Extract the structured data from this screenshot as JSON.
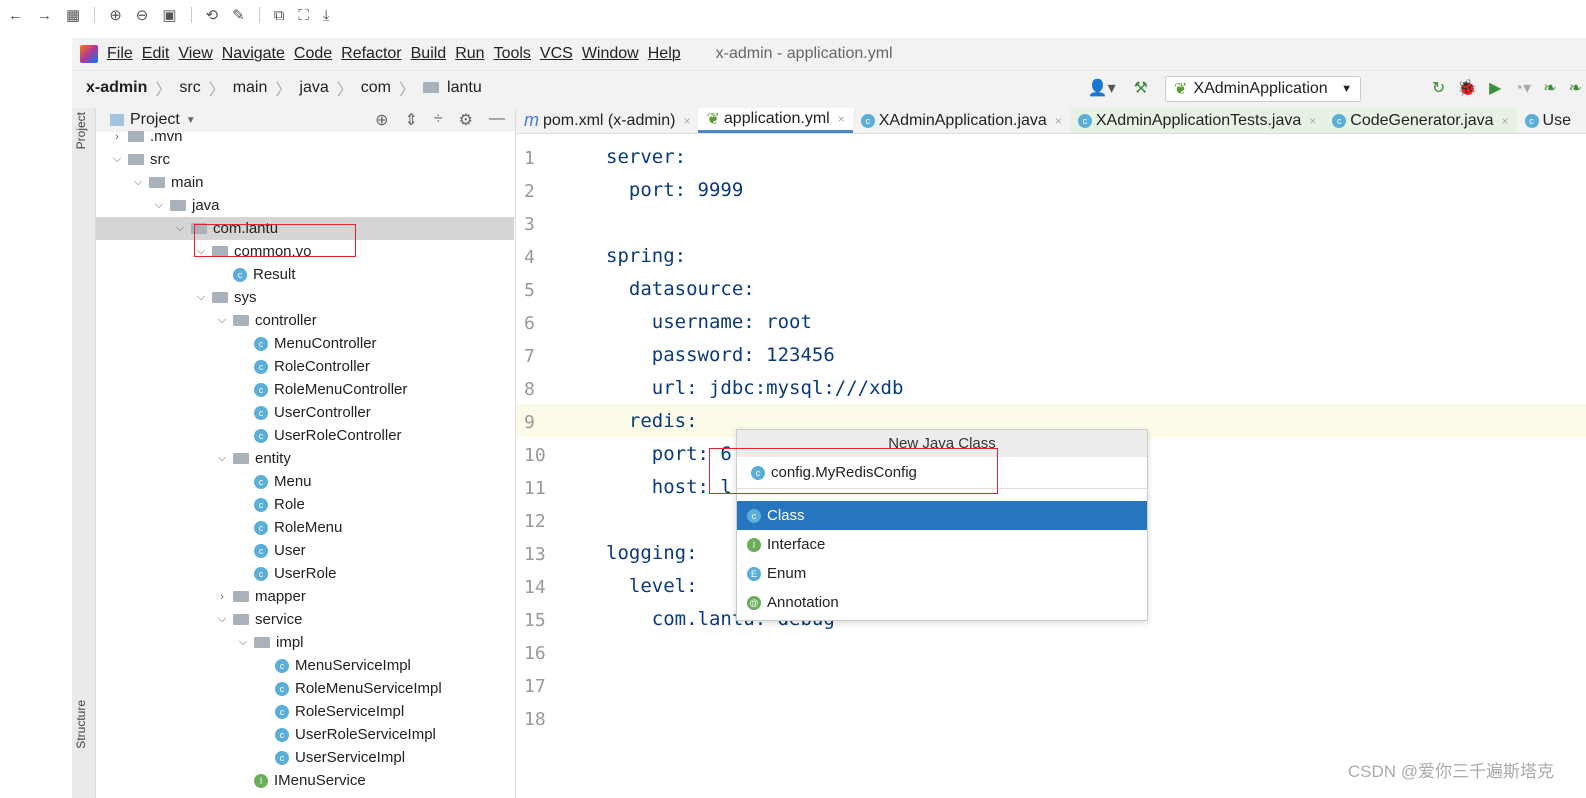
{
  "viewer_toolbar": {
    "icons": [
      "back-icon",
      "forward-icon",
      "grid-icon",
      "zoom-in-icon",
      "zoom-out-icon",
      "actual-size-icon",
      "rotate-icon",
      "edit-icon",
      "copy-text-icon",
      "screenshot-icon",
      "download-icon"
    ]
  },
  "menu": {
    "items": [
      "File",
      "Edit",
      "View",
      "Navigate",
      "Code",
      "Refactor",
      "Build",
      "Run",
      "Tools",
      "VCS",
      "Window",
      "Help"
    ],
    "window_title": "x-admin - application.yml"
  },
  "breadcrumb": [
    "x-admin",
    "src",
    "main",
    "java",
    "com",
    "lantu"
  ],
  "run_config": "XAdminApplication",
  "side_strip": {
    "project": "Project",
    "structure": "Structure"
  },
  "project_panel": {
    "title": "Project",
    "tree": [
      {
        "label": ".mvn",
        "level": 1,
        "kind": "folder",
        "expanded": false
      },
      {
        "label": "src",
        "level": 1,
        "kind": "folder",
        "expanded": true
      },
      {
        "label": "main",
        "level": 2,
        "kind": "folder",
        "expanded": true
      },
      {
        "label": "java",
        "level": 3,
        "kind": "folder",
        "expanded": true
      },
      {
        "label": "com.lantu",
        "level": 4,
        "kind": "folder",
        "expanded": true,
        "selected": true
      },
      {
        "label": "common.vo",
        "level": 5,
        "kind": "folder",
        "expanded": true
      },
      {
        "label": "Result",
        "level": 6,
        "kind": "class"
      },
      {
        "label": "sys",
        "level": 5,
        "kind": "folder",
        "expanded": true
      },
      {
        "label": "controller",
        "level": 6,
        "kind": "folder",
        "expanded": true
      },
      {
        "label": "MenuController",
        "level": 7,
        "kind": "class"
      },
      {
        "label": "RoleController",
        "level": 7,
        "kind": "class"
      },
      {
        "label": "RoleMenuController",
        "level": 7,
        "kind": "class"
      },
      {
        "label": "UserController",
        "level": 7,
        "kind": "class"
      },
      {
        "label": "UserRoleController",
        "level": 7,
        "kind": "class"
      },
      {
        "label": "entity",
        "level": 6,
        "kind": "folder",
        "expanded": true
      },
      {
        "label": "Menu",
        "level": 7,
        "kind": "class"
      },
      {
        "label": "Role",
        "level": 7,
        "kind": "class"
      },
      {
        "label": "RoleMenu",
        "level": 7,
        "kind": "class"
      },
      {
        "label": "User",
        "level": 7,
        "kind": "class"
      },
      {
        "label": "UserRole",
        "level": 7,
        "kind": "class"
      },
      {
        "label": "mapper",
        "level": 6,
        "kind": "folder",
        "expanded": false
      },
      {
        "label": "service",
        "level": 6,
        "kind": "folder",
        "expanded": true
      },
      {
        "label": "impl",
        "level": 7,
        "kind": "folder",
        "expanded": true
      },
      {
        "label": "MenuServiceImpl",
        "level": 8,
        "kind": "class"
      },
      {
        "label": "RoleMenuServiceImpl",
        "level": 8,
        "kind": "class"
      },
      {
        "label": "RoleServiceImpl",
        "level": 8,
        "kind": "class"
      },
      {
        "label": "UserRoleServiceImpl",
        "level": 8,
        "kind": "class"
      },
      {
        "label": "UserServiceImpl",
        "level": 8,
        "kind": "class"
      },
      {
        "label": "IMenuService",
        "level": 7,
        "kind": "interface"
      }
    ]
  },
  "tabs": [
    {
      "label": "pom.xml (x-admin)",
      "icon": "m"
    },
    {
      "label": "application.yml",
      "icon": "yml",
      "active": true
    },
    {
      "label": "XAdminApplication.java",
      "icon": "c"
    },
    {
      "label": "XAdminApplicationTests.java",
      "icon": "c"
    },
    {
      "label": "CodeGenerator.java",
      "icon": "c"
    },
    {
      "label": "Use",
      "icon": "c"
    }
  ],
  "code_lines": [
    "server:",
    "  port: 9999",
    "",
    "spring:",
    "  datasource:",
    "    username: root",
    "    password: 123456",
    "    url: jdbc:mysql:///xdb",
    "  redis:",
    "    port: 6",
    "    host: l",
    "",
    "logging:",
    "  level:",
    "    com.lantu: debug",
    "",
    "",
    ""
  ],
  "popup": {
    "title": "New Java Class",
    "input": "config.MyRedisConfig",
    "options": [
      "Class",
      "Interface",
      "Enum",
      "Annotation"
    ],
    "selected": "Class"
  },
  "watermark": "CSDN @爱你三千遍斯塔克"
}
